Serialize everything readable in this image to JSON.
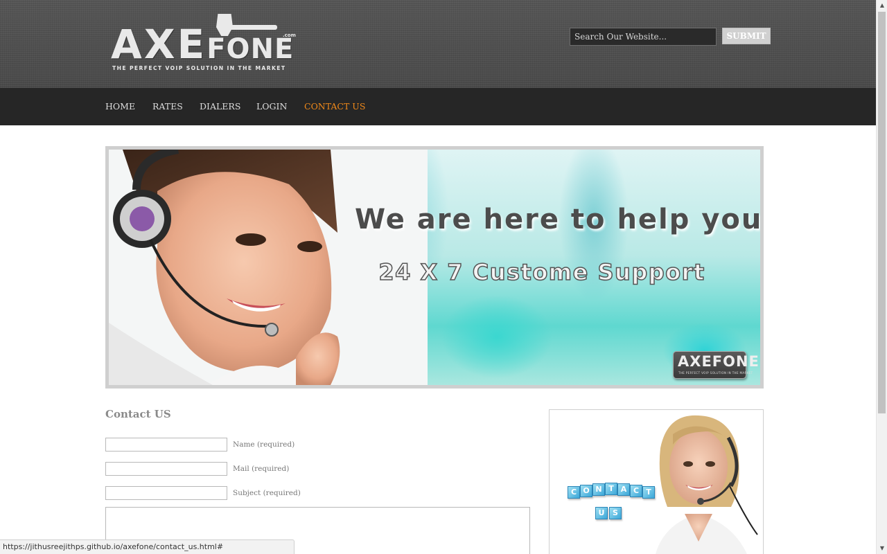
{
  "header": {
    "logo": {
      "brand_main": "AXE",
      "brand_sub": "FONE",
      "domain_suffix": ".com",
      "tagline": "THE PERFECT VOIP SOLUTION IN THE MARKET"
    },
    "search": {
      "placeholder": "Search Our Website...",
      "submit_label": "SUBMIT"
    }
  },
  "nav": {
    "items": [
      {
        "label": "HOME"
      },
      {
        "label": "RATES"
      },
      {
        "label": "DIALERS"
      },
      {
        "label": "LOGIN"
      },
      {
        "label": "CONTACT US",
        "active": true
      }
    ],
    "active_color": "#f0891a"
  },
  "banner": {
    "title": "We are here to help you",
    "subtitle": "24 X 7 Custome Support",
    "badge_brand": "AXEFONE",
    "badge_tagline": "THE PERFECT VOIP SOLUTION IN THE MARKET"
  },
  "contact": {
    "title": "Contact US",
    "fields": [
      {
        "label": "Name (required)",
        "value": ""
      },
      {
        "label": "Mail (required)",
        "value": ""
      },
      {
        "label": "Subject (required)",
        "value": ""
      }
    ],
    "message_value": ""
  },
  "sidebar_image": {
    "cube_word_1": [
      "C",
      "O",
      "N",
      "T",
      "A",
      "C",
      "T"
    ],
    "cube_word_2": [
      "U",
      "S"
    ]
  },
  "status_bar": {
    "url": "https://jithusreejithps.github.io/axefone/contact_us.html#"
  },
  "colors": {
    "header_bg": "#4e4e4e",
    "nav_bg": "#262626",
    "accent": "#f0891a"
  }
}
